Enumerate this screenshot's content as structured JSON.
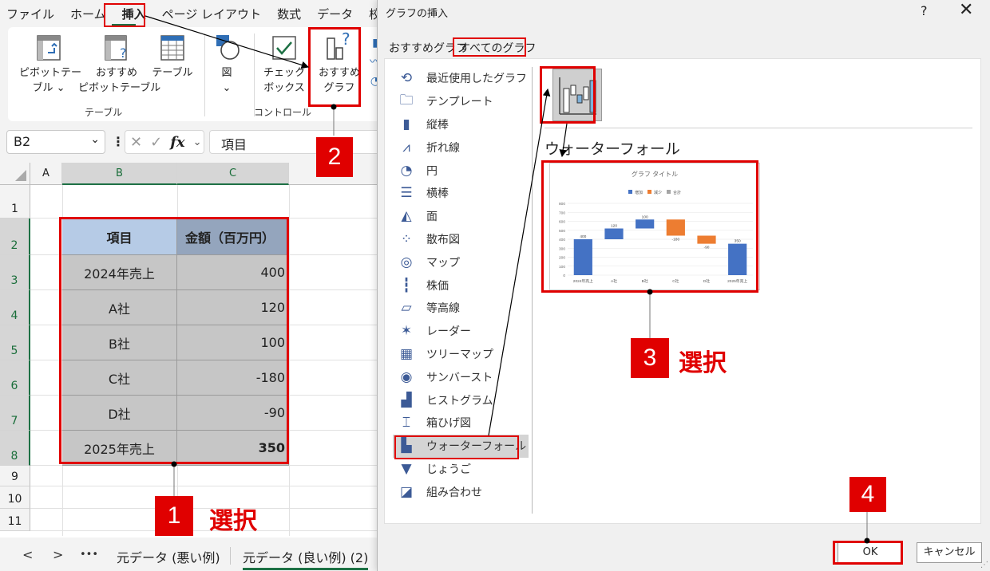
{
  "menu": {
    "items": [
      "ファイル",
      "ホーム",
      "挿入",
      "ページ レイアウト",
      "数式",
      "データ",
      "校閲"
    ],
    "active_index": 2
  },
  "ribbon": {
    "pivot_table": [
      "ピボットテー",
      "ブル ⌄"
    ],
    "recommended_pivot": [
      "おすすめ",
      "ピボットテーブル"
    ],
    "table": "テーブル",
    "figure": [
      "図",
      "⌄"
    ],
    "checkbox": [
      "チェック",
      "ボックス"
    ],
    "recommended_chart": [
      "おすすめ",
      "グラフ"
    ],
    "group_table": "テーブル",
    "group_control": "コントロール"
  },
  "formula_bar": {
    "name_box": "B2",
    "formula": "項目"
  },
  "sheet": {
    "col_headers": [
      "A",
      "B",
      "C"
    ],
    "row_numbers": [
      "1",
      "2",
      "3",
      "4",
      "5",
      "6",
      "7",
      "8",
      "9",
      "10",
      "11"
    ],
    "header": [
      "項目",
      "金額（百万円）"
    ],
    "rows": [
      [
        "2024年売上",
        "400"
      ],
      [
        "A社",
        "120"
      ],
      [
        "B社",
        "100"
      ],
      [
        "C社",
        "-180"
      ],
      [
        "D社",
        "-90"
      ],
      [
        "2025年売上",
        "350"
      ]
    ]
  },
  "sheet_tabs": {
    "nav_prev": "<",
    "nav_next": ">",
    "more": "•••",
    "tabs": [
      "元データ (悪い例)",
      "元データ (良い例) (2)"
    ],
    "active_index": 1
  },
  "annotations": {
    "step1": "1",
    "step2": "2",
    "step3": "3",
    "step4": "4",
    "select": "選択"
  },
  "dialog": {
    "title": "グラフの挿入",
    "help": "?",
    "close": "✕",
    "tabs": [
      "おすすめグラフ",
      "すべてのグラフ"
    ],
    "active_tab": 1,
    "chart_types": [
      {
        "label": "最近使用したグラフ",
        "icon": "undo-icon"
      },
      {
        "label": "テンプレート",
        "icon": "folder-icon"
      },
      {
        "label": "縦棒",
        "icon": "column-chart-icon"
      },
      {
        "label": "折れ線",
        "icon": "line-chart-icon"
      },
      {
        "label": "円",
        "icon": "pie-chart-icon"
      },
      {
        "label": "横棒",
        "icon": "bar-chart-icon"
      },
      {
        "label": "面",
        "icon": "area-chart-icon"
      },
      {
        "label": "散布図",
        "icon": "scatter-chart-icon"
      },
      {
        "label": "マップ",
        "icon": "globe-icon"
      },
      {
        "label": "株価",
        "icon": "stock-chart-icon"
      },
      {
        "label": "等高線",
        "icon": "surface-chart-icon"
      },
      {
        "label": "レーダー",
        "icon": "radar-chart-icon"
      },
      {
        "label": "ツリーマップ",
        "icon": "treemap-icon"
      },
      {
        "label": "サンバースト",
        "icon": "sunburst-icon"
      },
      {
        "label": "ヒストグラム",
        "icon": "histogram-icon"
      },
      {
        "label": "箱ひげ図",
        "icon": "box-whisker-icon"
      },
      {
        "label": "ウォーターフォール",
        "icon": "waterfall-icon"
      },
      {
        "label": "じょうご",
        "icon": "funnel-icon"
      },
      {
        "label": "組み合わせ",
        "icon": "combo-chart-icon"
      }
    ],
    "selected_type_index": 16,
    "subtype_title": "ウォーターフォール",
    "ok": "OK",
    "cancel": "キャンセル"
  },
  "colors": {
    "accent_red": "#e00000",
    "increase": "#4472c4",
    "decrease": "#ed7d31",
    "total": "#4472c4",
    "excel_green": "#1e7145"
  },
  "chart_data": {
    "type": "bar",
    "title": "グラフ タイトル",
    "legend": [
      "増加",
      "減少",
      "合計"
    ],
    "legend_position": "top",
    "categories": [
      "2024年売上",
      "A社",
      "B社",
      "C社",
      "D社",
      "2025年売上"
    ],
    "values": [
      400,
      120,
      100,
      -180,
      -90,
      350
    ],
    "data_labels": [
      "400",
      "120",
      "100",
      "-180",
      "-90",
      "350"
    ],
    "kind": [
      "total",
      "increase",
      "increase",
      "decrease",
      "decrease",
      "total"
    ],
    "y_ticks": [
      "0",
      "100",
      "200",
      "300",
      "400",
      "500",
      "600",
      "700",
      "800"
    ],
    "ylim": [
      0,
      800
    ],
    "grid": true
  }
}
